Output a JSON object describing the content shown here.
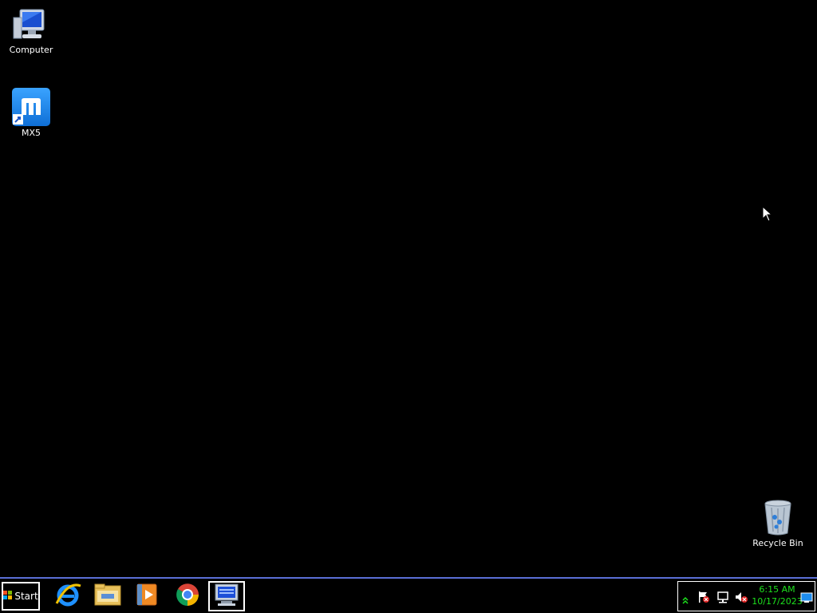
{
  "desktop": {
    "icons": [
      {
        "label": "Computer"
      },
      {
        "label": "MX5"
      },
      {
        "label": "Recycle Bin"
      }
    ]
  },
  "taskbar": {
    "start_label": "Start",
    "apps": [
      "internet-explorer-icon",
      "file-explorer-icon",
      "media-player-icon",
      "chrome-icon",
      "remote-desktop-icon"
    ],
    "tray": {
      "time": "6:15 AM",
      "date": "10/17/2023",
      "icons": [
        "show-hidden-icons-chevron-icon",
        "action-center-flag-icon",
        "network-icon",
        "volume-muted-icon",
        "show-desktop-icon"
      ]
    }
  },
  "colors": {
    "taskbar_border": "#5a6fd6",
    "clock_text": "#1de21d",
    "mx5_blue": "#1e8df0"
  }
}
